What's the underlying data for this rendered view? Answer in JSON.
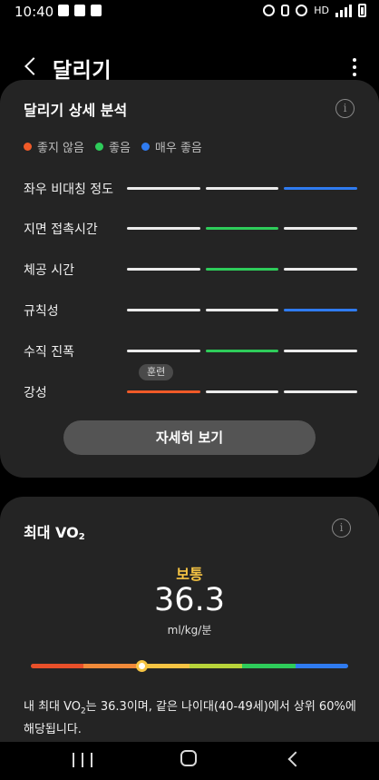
{
  "status_bar": {
    "time": "10:40",
    "network_label": "HD",
    "icons": [
      "upload-icon",
      "image-icon",
      "phone-icon",
      "alarm-icon",
      "bluetooth-icon",
      "wifi-icon",
      "signal-icon",
      "battery-icon"
    ]
  },
  "app_bar": {
    "title": "달리기",
    "back_icon": "chevron-left-icon",
    "menu_icon": "more-vert-icon"
  },
  "running_analysis": {
    "title": "달리기 상세 분석",
    "legend": [
      {
        "label": "좋지 않음",
        "color": "#f05a28"
      },
      {
        "label": "좋음",
        "color": "#2ecc5a"
      },
      {
        "label": "매우 좋음",
        "color": "#2f7bf0"
      }
    ],
    "neutral_color": "#ebebeb",
    "rows": [
      {
        "label": "좌우 비대칭 정도",
        "rating": 3
      },
      {
        "label": "지면 접촉시간",
        "rating": 2
      },
      {
        "label": "체공 시간",
        "rating": 2
      },
      {
        "label": "규칙성",
        "rating": 3
      },
      {
        "label": "수직 진폭",
        "rating": 2
      },
      {
        "label": "강성",
        "rating": 1
      }
    ],
    "tooltip": "훈련",
    "detail_button": "자세히 보기"
  },
  "vo2": {
    "title_main": "최대 VO",
    "title_sub": "2",
    "level": "보통",
    "value": "36.3",
    "unit": "ml/kg/분",
    "scale_position": 0.352,
    "scale_colors": [
      "#e8502a",
      "#f18a3a",
      "#f6c443",
      "#b8d43a",
      "#2ecc5a",
      "#2f7bf0"
    ],
    "desc_prefix": "내 최대 VO",
    "desc_sub": "2",
    "desc_suffix": "는 36.3이며, 같은 나이대(40-49세)에서 상위 60%에 해당됩니다."
  }
}
